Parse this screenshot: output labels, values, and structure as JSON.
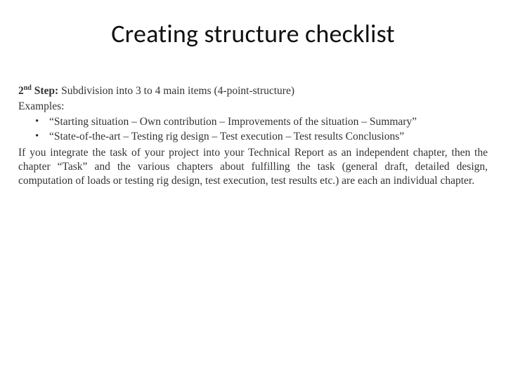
{
  "title": "Creating structure checklist",
  "step": {
    "ordinal_html": "2<sup>nd</sup> Step:",
    "description": "Subdivision into 3 to 4 main items (4-point-structure)"
  },
  "examples_label": "Examples:",
  "examples": [
    "“Starting situation – Own contribution – Improvements of the situation – Summary”",
    "“State-of-the-art – Testing rig design – Test execution – Test results   Conclusions”"
  ],
  "paragraph": "If you integrate the task of your project into your Technical Report as an independent chapter, then the chapter “Task” and the various chapters about fulfilling the task (general draft, detailed design, computation of loads or testing rig design, test execution, test results etc.) are each an individual chapter."
}
